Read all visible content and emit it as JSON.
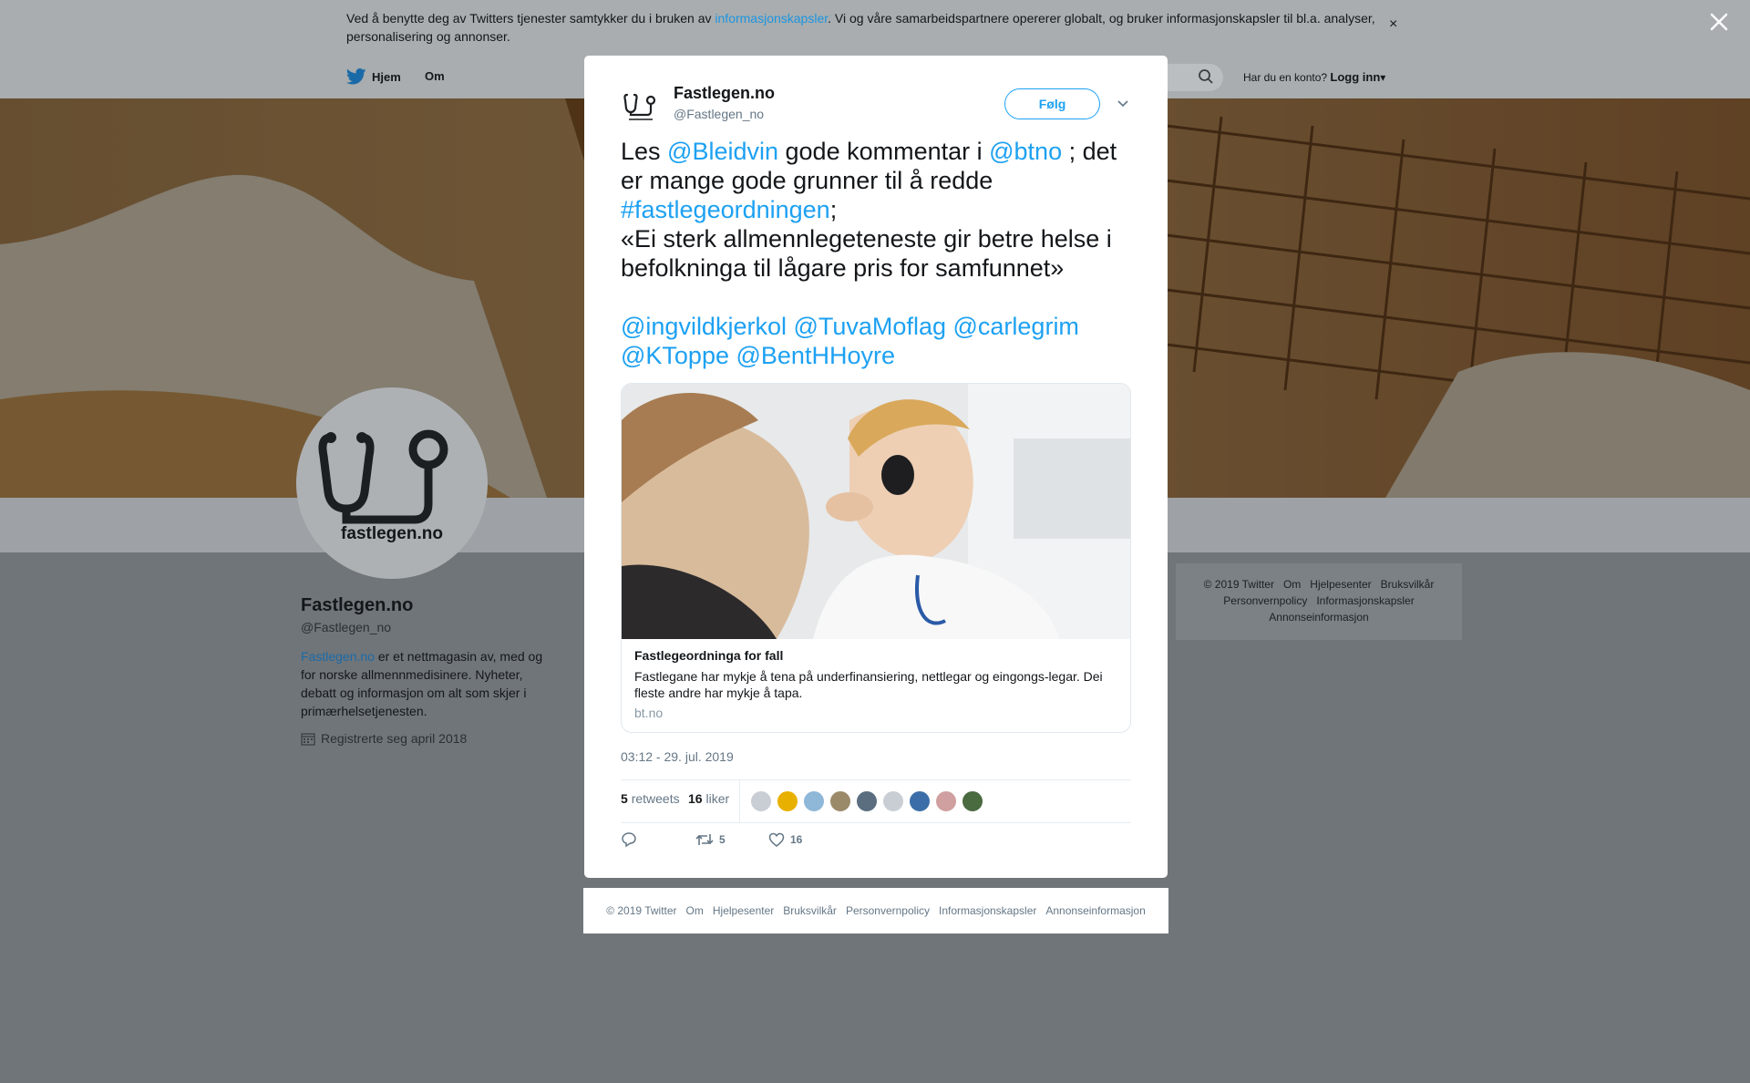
{
  "cookie_bar": {
    "text_before": "Ved å benytte deg av Twitters tjenester samtykker du i bruken av ",
    "link": "informasjonskapsler",
    "text_after": ". Vi og våre samarbeidspartnere opererer globalt, og bruker informasjonskapsler til bl.a. analyser, personalisering og annonser.",
    "close": "×"
  },
  "nav": {
    "home": "Hjem",
    "about": "Om",
    "account_prompt": "Har du en konto?",
    "login": "Logg inn"
  },
  "profile": {
    "avatar_text": "fastlegen.no",
    "name": "Fastlegen.no",
    "handle": "@Fastlegen_no",
    "bio_link": "Fastlegen.no",
    "bio_text": " er et nettmagasin av, med og for norske allmennmedisinere. Nyheter, debatt og informasjon om alt som skjer i primærhelsetjenesten.",
    "joined": "Registrerte seg april 2018"
  },
  "side_footer": {
    "items": [
      "© 2019 Twitter",
      "Om",
      "Hjelpesenter",
      "Bruksvilkår",
      "Personvernpolicy",
      "Informasjonskapsler",
      "Annonseinformasjon"
    ]
  },
  "tweet": {
    "author_name": "Fastlegen.no",
    "author_handle": "@Fastlegen_no",
    "follow_label": "Følg",
    "text": {
      "t1": "Les ",
      "m1": "@Bleidvin",
      "t2": " gode kommentar i ",
      "m2": "@btno",
      "t3": " ; det er mange gode grunner til å redde ",
      "h1": "#fastlegeordningen",
      "t4": ";",
      "quote": "«Ei sterk allmennlegeteneste gir betre helse i befolkninga til lågare pris for samfunnet»",
      "mentions": [
        "@ingvildkjerkol",
        "@TuvaMoflag",
        "@carlegrim",
        "@KToppe",
        "@BentHHoyre"
      ]
    },
    "card": {
      "title": "Fastlegeordninga for fall",
      "description": "Fastlegane har mykje å tena på underfinansiering, nettlegar og eingongs-legar. Dei fleste andre har mykje å tapa.",
      "domain": "bt.no"
    },
    "timestamp": "03:12 - 29. jul. 2019",
    "retweets_count": "5",
    "retweets_label": "retweets",
    "likes_count": "16",
    "likes_label": "liker",
    "action_retweets": "5",
    "action_likes": "16",
    "liker_colors": [
      "#c8ced4",
      "#e8b000",
      "#8fb7d8",
      "#9b8a6a",
      "#5a6e80",
      "#c8ced4",
      "#3b6ea8",
      "#d0a0a0",
      "#4a6a40"
    ]
  },
  "modal_footer": {
    "items": [
      "© 2019 Twitter",
      "Om",
      "Hjelpesenter",
      "Bruksvilkår",
      "Personvernpolicy",
      "Informasjonskapsler",
      "Annonseinformasjon"
    ]
  },
  "colors": {
    "accent": "#1da1f2",
    "overlay": "#707579"
  }
}
